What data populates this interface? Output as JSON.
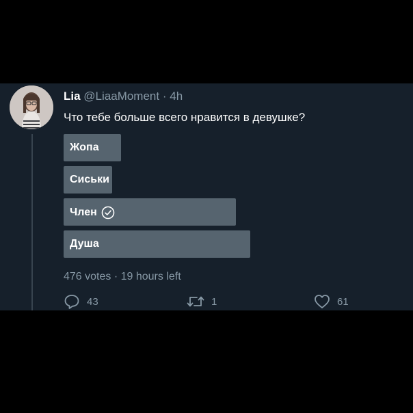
{
  "tweet": {
    "display_name": "Lia",
    "handle": "@LiaaMoment",
    "separator": "·",
    "time": "4h",
    "text": "Что тебе больше всего нравится в девушке?"
  },
  "poll": {
    "options": [
      {
        "label": "Жопа",
        "fraction": 0.2,
        "selected": false
      },
      {
        "label": "Сиськи",
        "fraction": 0.17,
        "selected": false
      },
      {
        "label": "Член",
        "fraction": 0.6,
        "selected": true
      },
      {
        "label": "Душа",
        "fraction": 0.65,
        "selected": false
      }
    ],
    "summary": "476 votes · 19 hours left"
  },
  "actions": {
    "reply_count": "43",
    "retweet_count": "1",
    "like_count": "61"
  },
  "icons": [
    "reply-icon",
    "retweet-icon",
    "like-icon",
    "check-circle-icon"
  ],
  "colors": {
    "background": "#16202b",
    "poll_bar": "#56646f",
    "muted_text": "#8899a6"
  }
}
